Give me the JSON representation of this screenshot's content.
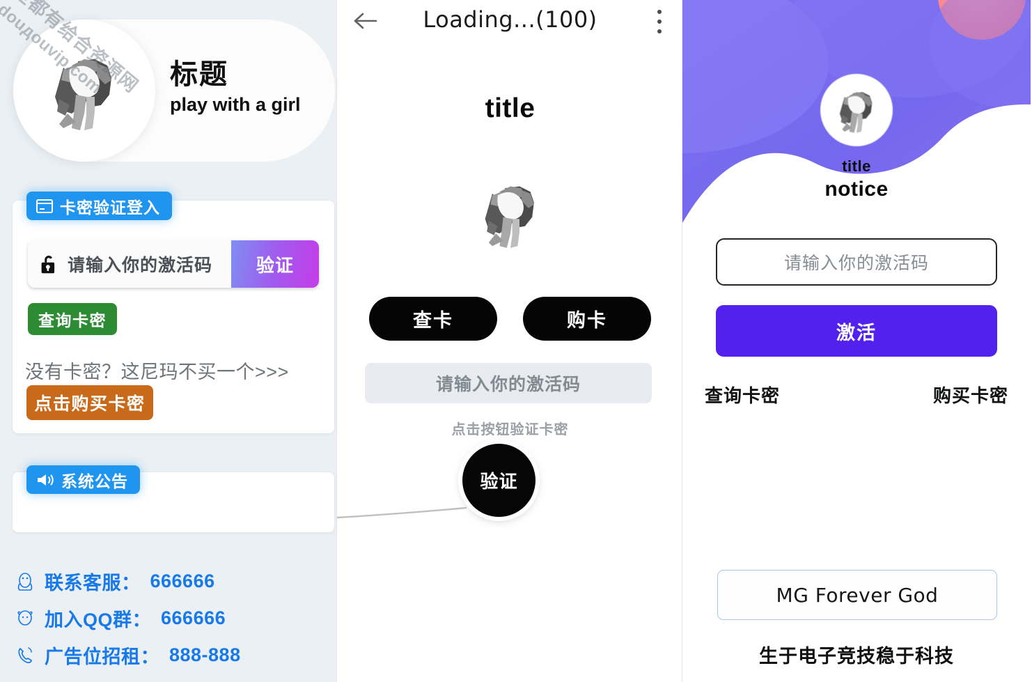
{
  "watermark": {
    "line1": "全都有给合资源网",
    "line2": "douдouvip.com"
  },
  "left_panel": {
    "header": {
      "title_cn": "标题",
      "title_en": "play with a girl",
      "avatar_icon": "abstract-figure-illustration"
    },
    "login_card": {
      "tag_label": "卡密验证登入",
      "tag_icon": "card-icon",
      "input_icon": "unlock-icon",
      "input_placeholder": "请输入你的激活码",
      "input_value": "",
      "verify_label": "验证",
      "query_label": "查询卡密",
      "no_card_text": "没有卡密？这尼玛不买一个>>>",
      "buy_label": "点击购买卡密"
    },
    "notice_card": {
      "tag_label": "系统公告",
      "tag_icon": "speaker-icon",
      "body_text": ""
    },
    "contacts": [
      {
        "icon": "qq-penguin-icon",
        "label": "联系客服：",
        "value": "666666"
      },
      {
        "icon": "qq-group-icon",
        "label": "加入QQ群：",
        "value": "666666"
      },
      {
        "icon": "phone-icon",
        "label": "广告位招租：",
        "value": "888-888"
      }
    ],
    "colors": {
      "background": "#eaf0f4",
      "tag_blue": "#1f95f0",
      "query_green": "#2d8b34",
      "buy_orange": "#c96a1b",
      "verify_gradient_start": "#7f8ef2",
      "verify_gradient_end": "#c63ce8",
      "contact_blue": "#1879e8"
    }
  },
  "mid_panel": {
    "topbar": {
      "back_icon": "back-arrow-icon",
      "title": "Loading...(100)",
      "menu_icon": "kebab-menu-icon"
    },
    "title_word": "title",
    "art_icon": "abstract-figure-illustration",
    "buttons": {
      "check_card": "查卡",
      "buy_card": "购卡"
    },
    "input_placeholder": "请输入你的激活码",
    "input_value": "",
    "hint_text": "点击按钮验证卡密",
    "circle_button_label": "验证",
    "colors": {
      "background": "#ffffff",
      "pill_black": "#050505",
      "input_gray": "#e8ebef",
      "hint_gray": "#9aa0a6"
    }
  },
  "right_panel": {
    "hero": {
      "avatar_icon": "abstract-figure-illustration",
      "title": "title",
      "notice": "notice",
      "bg_purple": "#7b6ef0",
      "bg_purple_deep": "#6d4fe6",
      "accent_pink": "#fb8b93"
    },
    "input_placeholder": "请输入你的激活码",
    "input_value": "",
    "activate_label": "激活",
    "activate_color": "#5221ee",
    "links": {
      "query": "查询卡密",
      "buy": "购买卡密"
    },
    "footer_box_text": "MG Forever God",
    "footer_text": "生于电子竞技稳于科技",
    "footer_border_color": "#a9c6ea"
  }
}
